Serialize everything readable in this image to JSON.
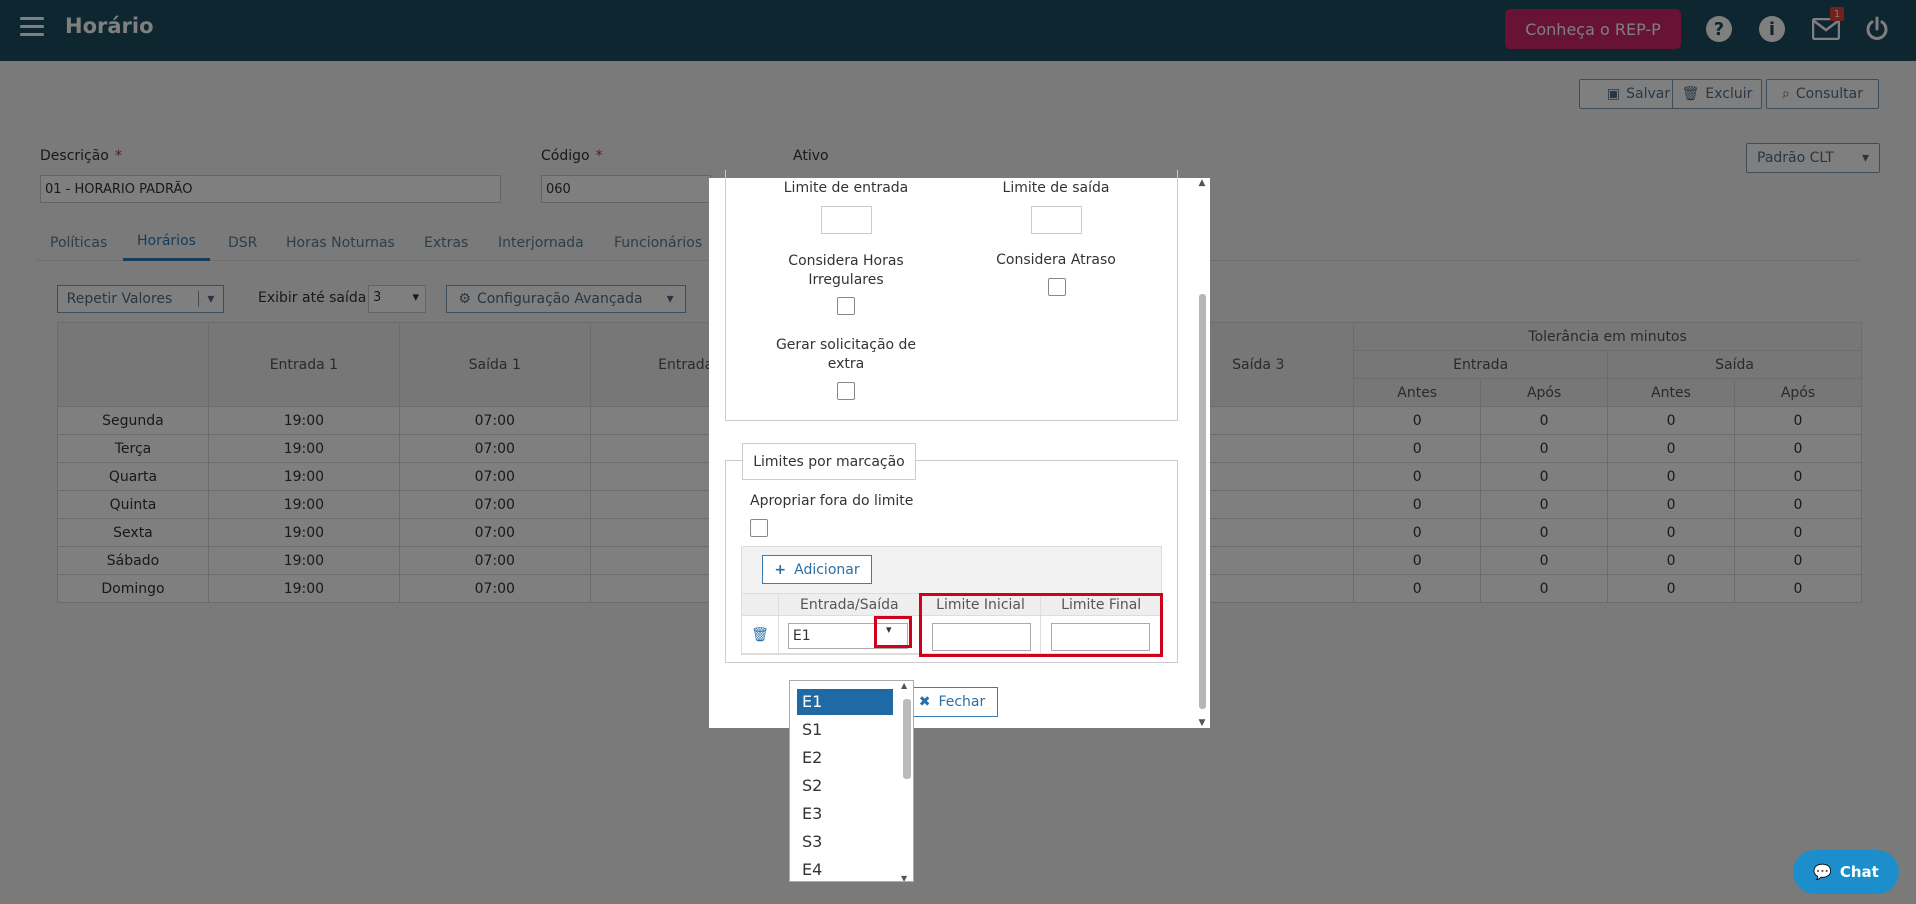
{
  "header": {
    "title": "Horário",
    "rep_button": "Conheça o REP-P",
    "notification_count": "1",
    "help": "?",
    "info": "i"
  },
  "actions": {
    "save": "Salvar",
    "delete": "Excluir",
    "query": "Consultar",
    "profile_select": "Padrão CLT"
  },
  "form": {
    "description_label": "Descrição",
    "description_value": "01 - HORARIO PADRÃO",
    "code_label": "Código",
    "code_value": "060",
    "active_label": "Ativo",
    "required_mark": "*"
  },
  "tabs": [
    "Políticas",
    "Horários",
    "DSR",
    "Horas Noturnas",
    "Extras",
    "Interjornada",
    "Funcionários"
  ],
  "toolbar": {
    "repeat": "Repetir Valores",
    "show_until_label": "Exibir até saída:",
    "show_until_value": "3",
    "advanced": "Configuração Avançada"
  },
  "table": {
    "tolerance_header": "Tolerância em minutos",
    "entrada": "Entrada",
    "saida": "Saída",
    "col_e1": "Entrada 1",
    "col_s1": "Saída 1",
    "col_e2": "Entrada",
    "col_s3": "Saída 3",
    "antes": "Antes",
    "apos": "Após",
    "rows": [
      {
        "day": "Segunda",
        "e1": "19:00",
        "s1": "07:00",
        "t1": "0",
        "t2": "0",
        "t3": "0",
        "t4": "0"
      },
      {
        "day": "Terça",
        "e1": "19:00",
        "s1": "07:00",
        "t1": "0",
        "t2": "0",
        "t3": "0",
        "t4": "0"
      },
      {
        "day": "Quarta",
        "e1": "19:00",
        "s1": "07:00",
        "t1": "0",
        "t2": "0",
        "t3": "0",
        "t4": "0"
      },
      {
        "day": "Quinta",
        "e1": "19:00",
        "s1": "07:00",
        "t1": "0",
        "t2": "0",
        "t3": "0",
        "t4": "0"
      },
      {
        "day": "Sexta",
        "e1": "19:00",
        "s1": "07:00",
        "t1": "0",
        "t2": "0",
        "t3": "0",
        "t4": "0"
      },
      {
        "day": "Sábado",
        "e1": "19:00",
        "s1": "07:00",
        "t1": "0",
        "t2": "0",
        "t3": "0",
        "t4": "0"
      },
      {
        "day": "Domingo",
        "e1": "19:00",
        "s1": "07:00",
        "t1": "0",
        "t2": "0",
        "t3": "0",
        "t4": "0"
      }
    ]
  },
  "modal": {
    "limit_entry": "Limite de entrada",
    "limit_exit": "Limite de saída",
    "irregular_1": "Considera Horas",
    "irregular_2": "Irregulares",
    "delay": "Considera Atraso",
    "extra_1": "Gerar solicitação de",
    "extra_2": "extra",
    "legend": "Limites por marcação",
    "appropriate": "Apropriar fora do limite",
    "add": "Adicionar",
    "col_es": "Entrada/Saída",
    "col_start": "Limite Inicial",
    "col_end": "Limite Final",
    "row_value": "E1",
    "close": "Fechar"
  },
  "dropdown": [
    "E1",
    "S1",
    "E2",
    "S2",
    "E3",
    "S3",
    "E4"
  ],
  "chat": "Chat"
}
